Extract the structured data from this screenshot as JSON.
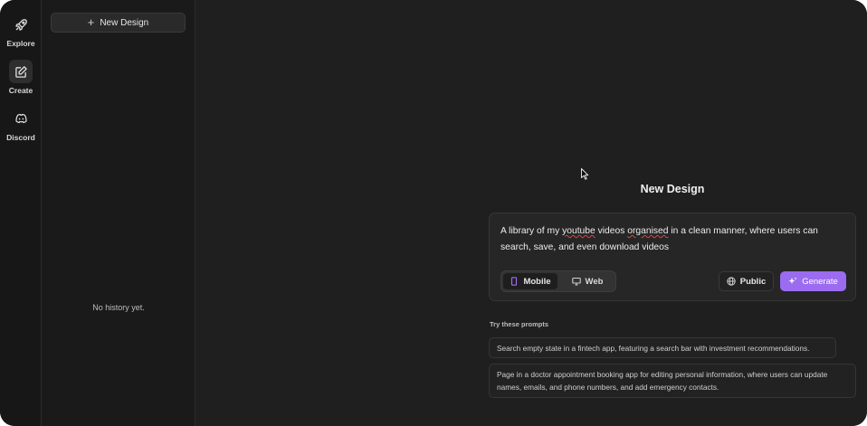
{
  "rail": {
    "items": [
      {
        "label": "Explore",
        "icon": "rocket-icon"
      },
      {
        "label": "Create",
        "icon": "edit-icon"
      },
      {
        "label": "Discord",
        "icon": "discord-icon"
      }
    ]
  },
  "history": {
    "new_design_label": "New Design",
    "empty_text": "No history yet."
  },
  "main": {
    "title": "New Design",
    "prompt": {
      "seg1": "A library of my ",
      "seg2": "youtube",
      "seg3": " videos ",
      "seg4": "organised",
      "seg5": " in a clean manner, where users can search, save, and even download videos"
    },
    "mode_mobile": "Mobile",
    "mode_web": "Web",
    "public_label": "Public",
    "generate_label": "Generate",
    "try_label": "Try these prompts",
    "suggestions": [
      "Search empty state in a fintech app, featuring a search bar with investment recommendations.",
      "Page in a doctor appointment booking app for editing personal information, where users can update names, emails, and phone numbers, and add emergency contacts."
    ]
  },
  "colors": {
    "accent": "#9b6cf0",
    "background": "#1f1f1f",
    "rail": "#171717"
  }
}
